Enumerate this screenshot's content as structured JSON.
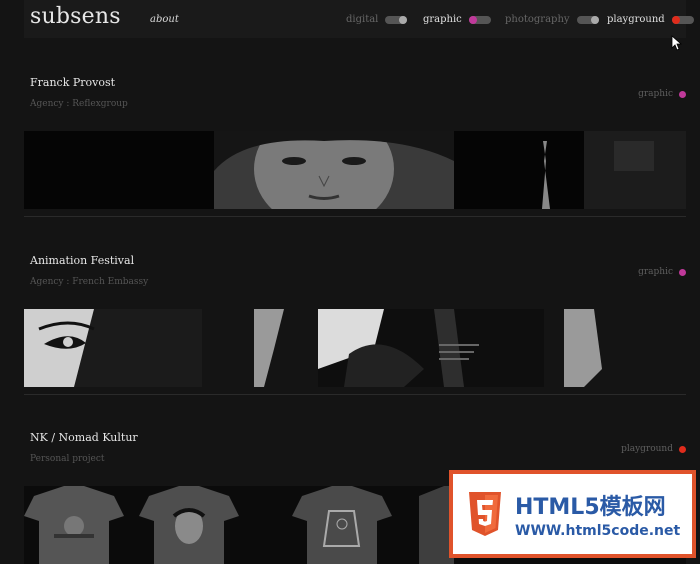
{
  "header": {
    "logo": "subsens",
    "about_link": "about",
    "filters": [
      {
        "label": "digital",
        "active": false,
        "knob_color": "#aaaaaa",
        "knob_side": "right"
      },
      {
        "label": "graphic",
        "active": true,
        "knob_color": "#c0399a",
        "knob_side": "left"
      },
      {
        "label": "photography",
        "active": false,
        "knob_color": "#aaaaaa",
        "knob_side": "right"
      },
      {
        "label": "playground",
        "active": true,
        "knob_color": "#e02c1c",
        "knob_side": "left"
      }
    ]
  },
  "projects": [
    {
      "title": "Franck Provost",
      "agency": "Agency : Reflexgroup",
      "category": "graphic",
      "category_color": "#c0399a"
    },
    {
      "title": "Animation Festival",
      "agency": "Agency : French Embassy",
      "category": "graphic",
      "category_color": "#c0399a"
    },
    {
      "title": "NK / Nomad Kultur",
      "agency": "Personal project",
      "category": "playground",
      "category_color": "#e02c1c"
    }
  ],
  "watermark": {
    "logo_icon": "html5-shield-icon",
    "line1": "HTML5模板网",
    "line2": "WWW.html5code.net"
  },
  "colors": {
    "graphic": "#c0399a",
    "playground": "#e02c1c",
    "background": "#141414"
  }
}
